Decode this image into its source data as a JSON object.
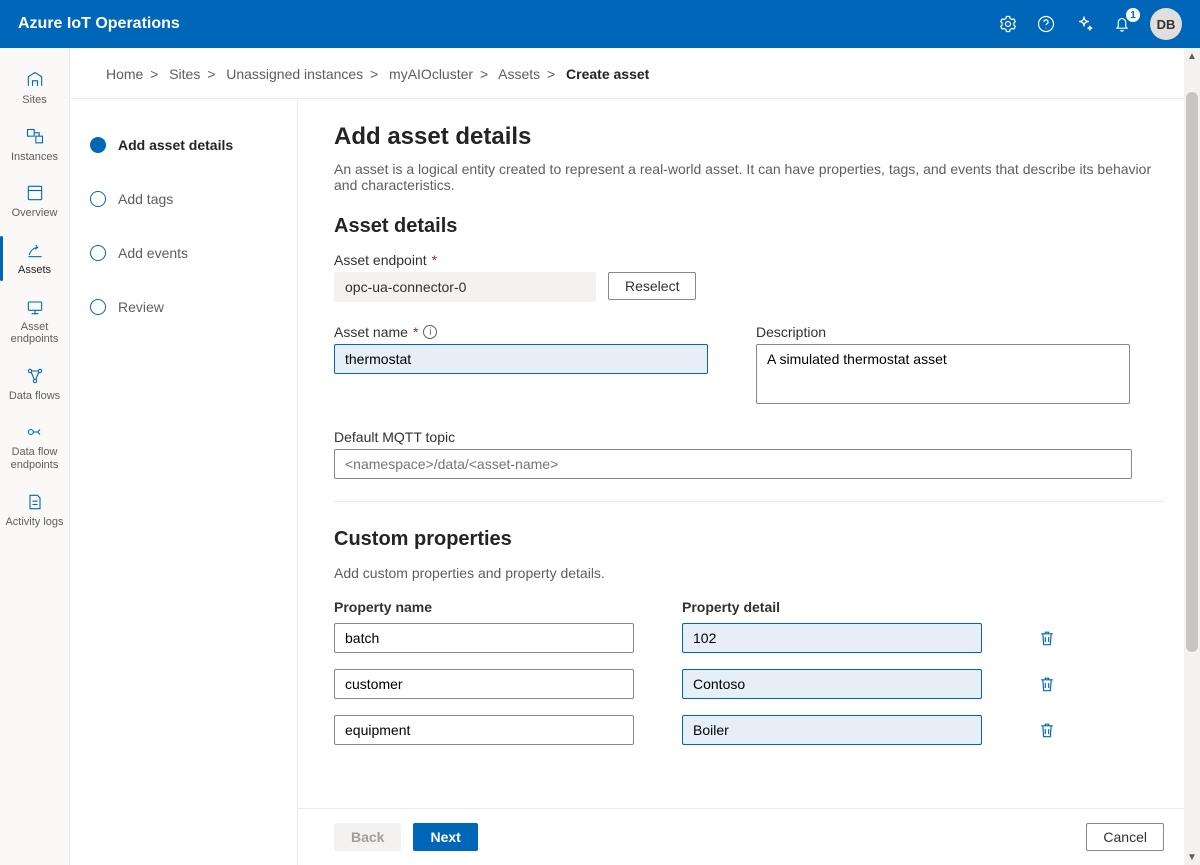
{
  "header": {
    "title": "Azure IoT Operations",
    "notification_count": "1",
    "avatar_initials": "DB"
  },
  "rail": {
    "items": [
      {
        "id": "sites",
        "label": "Sites"
      },
      {
        "id": "instances",
        "label": "Instances"
      },
      {
        "id": "overview",
        "label": "Overview"
      },
      {
        "id": "assets",
        "label": "Assets",
        "active": true
      },
      {
        "id": "asset-endpoints",
        "label": "Asset endpoints"
      },
      {
        "id": "dataflows",
        "label": "Data flows"
      },
      {
        "id": "dataflow-endpoints",
        "label": "Data flow endpoints"
      },
      {
        "id": "activity-logs",
        "label": "Activity logs"
      }
    ]
  },
  "breadcrumb": {
    "items": [
      "Home",
      "Sites",
      "Unassigned instances",
      "myAIOcluster",
      "Assets"
    ],
    "current": "Create asset"
  },
  "wizard": {
    "steps": [
      {
        "label": "Add asset details",
        "active": true
      },
      {
        "label": "Add tags"
      },
      {
        "label": "Add events"
      },
      {
        "label": "Review"
      }
    ]
  },
  "page": {
    "title": "Add asset details",
    "lead": "An asset is a logical entity created to represent a real-world asset. It can have properties, tags, and events that describe its behavior and characteristics.",
    "section_details": "Asset details",
    "endpoint_label": "Asset endpoint",
    "endpoint_value": "opc-ua-connector-0",
    "reselect_label": "Reselect",
    "name_label": "Asset name",
    "name_value": "thermostat",
    "desc_label": "Description",
    "desc_value": "A simulated thermostat asset",
    "mqtt_label": "Default MQTT topic",
    "mqtt_placeholder": "<namespace>/data/<asset-name>",
    "section_custom": "Custom properties",
    "custom_lead": "Add custom properties and property details.",
    "col_name": "Property name",
    "col_detail": "Property detail",
    "properties": [
      {
        "name": "batch",
        "detail": "102"
      },
      {
        "name": "customer",
        "detail": "Contoso"
      },
      {
        "name": "equipment",
        "detail": "Boiler"
      }
    ]
  },
  "footer": {
    "back": "Back",
    "next": "Next",
    "cancel": "Cancel"
  }
}
